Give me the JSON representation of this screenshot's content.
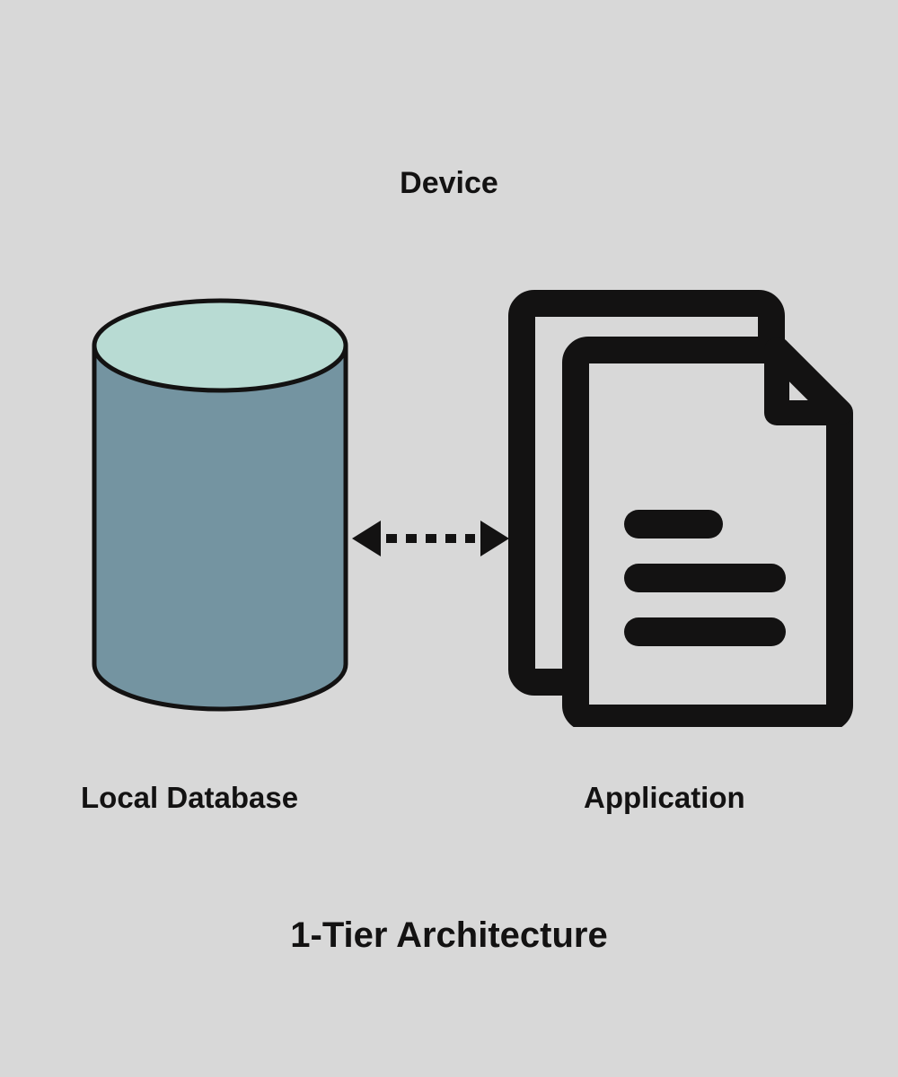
{
  "diagram": {
    "title_top": "Device",
    "left_label": "Local Database",
    "right_label": "Application",
    "caption": "1-Tier Architecture",
    "icons": {
      "left": "database-cylinder",
      "right": "documents-stack",
      "connector": "bidirectional-dotted-arrow"
    },
    "colors": {
      "background": "#d8d8d8",
      "cylinder_top": "#b8dbd3",
      "cylinder_side": "#7494a1",
      "stroke": "#131212",
      "icon": "#131212",
      "text": "#131212"
    }
  }
}
